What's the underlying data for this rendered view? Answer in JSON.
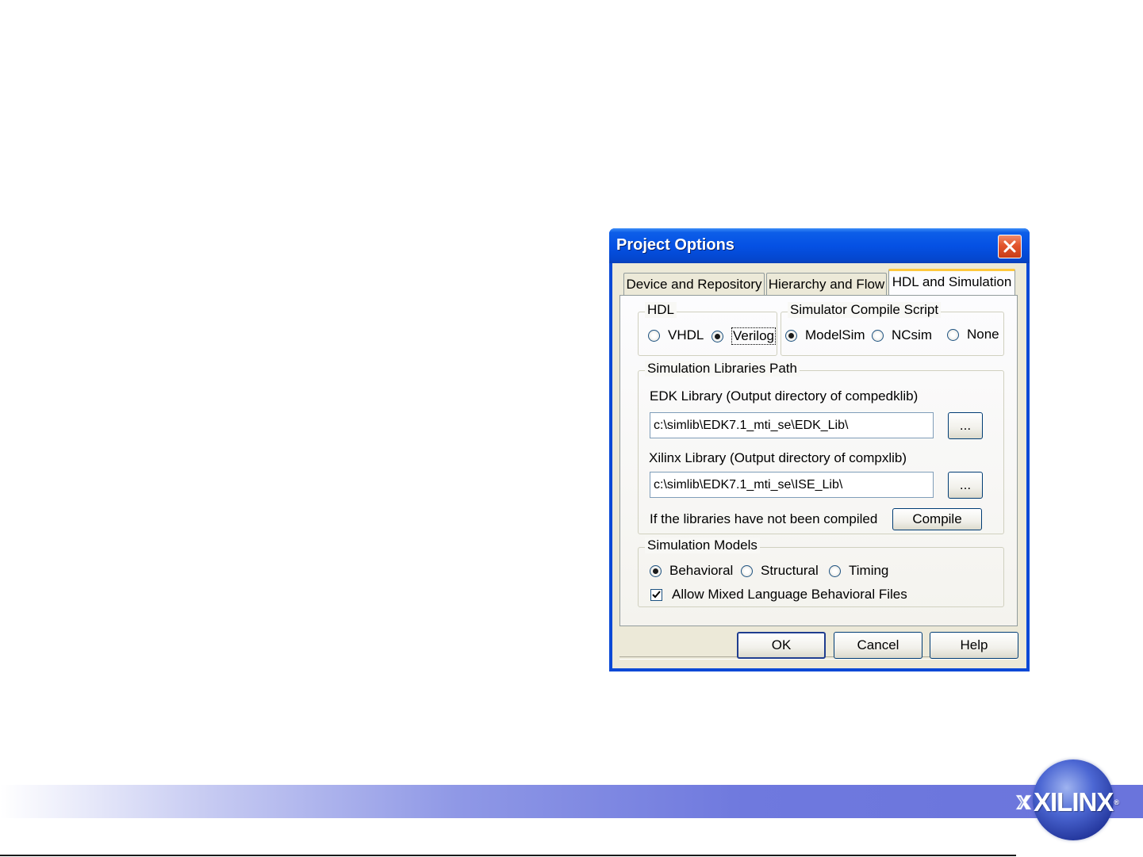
{
  "dialog": {
    "title": "Project Options",
    "tabs": [
      {
        "label": "Device and Repository",
        "active": false
      },
      {
        "label": "Hierarchy and Flow",
        "active": false
      },
      {
        "label": "HDL and Simulation",
        "active": true
      }
    ],
    "hdl": {
      "legend": "HDL",
      "options": [
        "VHDL",
        "Verilog"
      ],
      "selected": "Verilog"
    },
    "simulator": {
      "legend": "Simulator Compile Script",
      "options": [
        "ModelSim",
        "NCsim",
        "None"
      ],
      "selected": "ModelSim"
    },
    "libraries": {
      "legend": "Simulation Libraries Path",
      "edk_label": "EDK Library (Output directory of compedklib)",
      "edk_value": "c:\\simlib\\EDK7.1_mti_se\\EDK_Lib\\",
      "xilinx_label": "Xilinx Library (Output directory of compxlib)",
      "xilinx_value": "c:\\simlib\\EDK7.1_mti_se\\ISE_Lib\\",
      "browse_label": "...",
      "compile_note": "If the libraries have not been compiled",
      "compile_button": "Compile"
    },
    "models": {
      "legend": "Simulation Models",
      "options": [
        "Behavioral",
        "Structural",
        "Timing"
      ],
      "selected": "Behavioral",
      "mixed_label": "Allow Mixed Language Behavioral Files",
      "mixed_checked": true
    },
    "buttons": {
      "ok": "OK",
      "cancel": "Cancel",
      "help": "Help"
    }
  },
  "logo": {
    "text": "XILINX",
    "registered": "®"
  },
  "colors": {
    "titlebar": "#0551e4",
    "dialog_face": "#ece9d8",
    "footer_band": "#6f79de",
    "logo_globe": "#2d44b5"
  }
}
